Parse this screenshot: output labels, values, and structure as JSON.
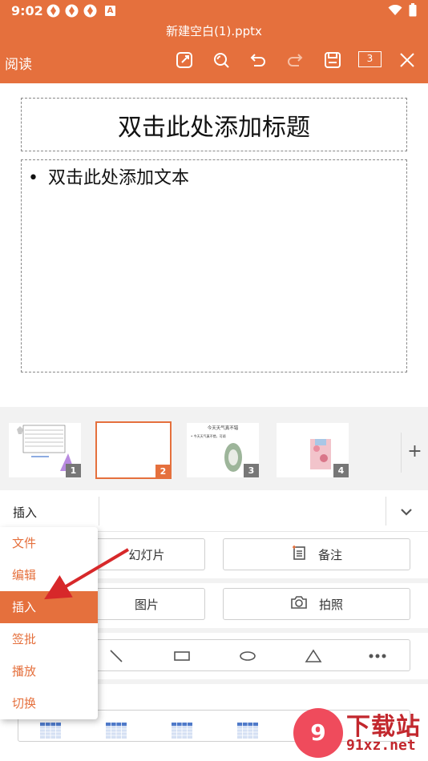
{
  "status_bar": {
    "time": "9:02",
    "notif_letter": "A"
  },
  "header": {
    "file_title": "新建空白(1).pptx",
    "read_label": "阅读",
    "page_count": "3"
  },
  "slide": {
    "title_placeholder": "双击此处添加标题",
    "body_bullet": "•",
    "body_placeholder": "双击此处添加文本"
  },
  "thumbnails": [
    {
      "num": "1"
    },
    {
      "num": "2"
    },
    {
      "num": "3",
      "title": "今天天气真不错",
      "text": "• 今天天气真不错，可颂"
    },
    {
      "num": "4"
    }
  ],
  "add_slide": "+",
  "panel": {
    "current_tab": "插入",
    "buttons": {
      "slide": "幻灯片",
      "notes": "备注",
      "picture": "图片",
      "photo": "拍照"
    }
  },
  "menu": {
    "items": [
      "文件",
      "编辑",
      "插入",
      "签批",
      "播放",
      "切换"
    ],
    "selected": "插入"
  },
  "watermark": {
    "logo": "9",
    "name": "下载站",
    "url": "91xz.net"
  },
  "colors": {
    "accent": "#e5703d",
    "arrow": "#d7282a"
  }
}
